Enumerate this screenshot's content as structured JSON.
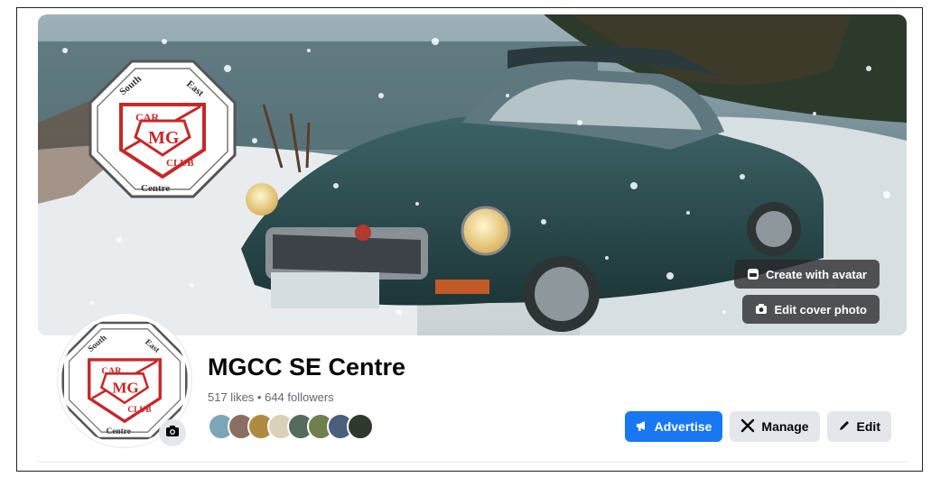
{
  "cover": {
    "create_avatar_label": "Create with avatar",
    "edit_cover_label": "Edit cover photo",
    "logo": {
      "top_text_left": "South",
      "top_text_right": "East",
      "badge_top": "CAR",
      "badge_mid": "MG",
      "badge_bottom": "CLUB",
      "bottom_text": "Centre"
    }
  },
  "profile": {
    "name": "MGCC SE Centre",
    "stats": "517 likes • 644 followers",
    "friend_avatars": [
      "#7aa6b8",
      "#8d6e63",
      "#b08a3e",
      "#d9d2b8",
      "#556b5f",
      "#6f7f4e",
      "#4a5f7d",
      "#2f3a2f"
    ]
  },
  "actions": {
    "advertise_label": "Advertise",
    "manage_label": "Manage",
    "edit_label": "Edit"
  },
  "colors": {
    "primary": "#1877f2",
    "secondary_bg": "#e4e6eb",
    "logo_red": "#c62828"
  }
}
